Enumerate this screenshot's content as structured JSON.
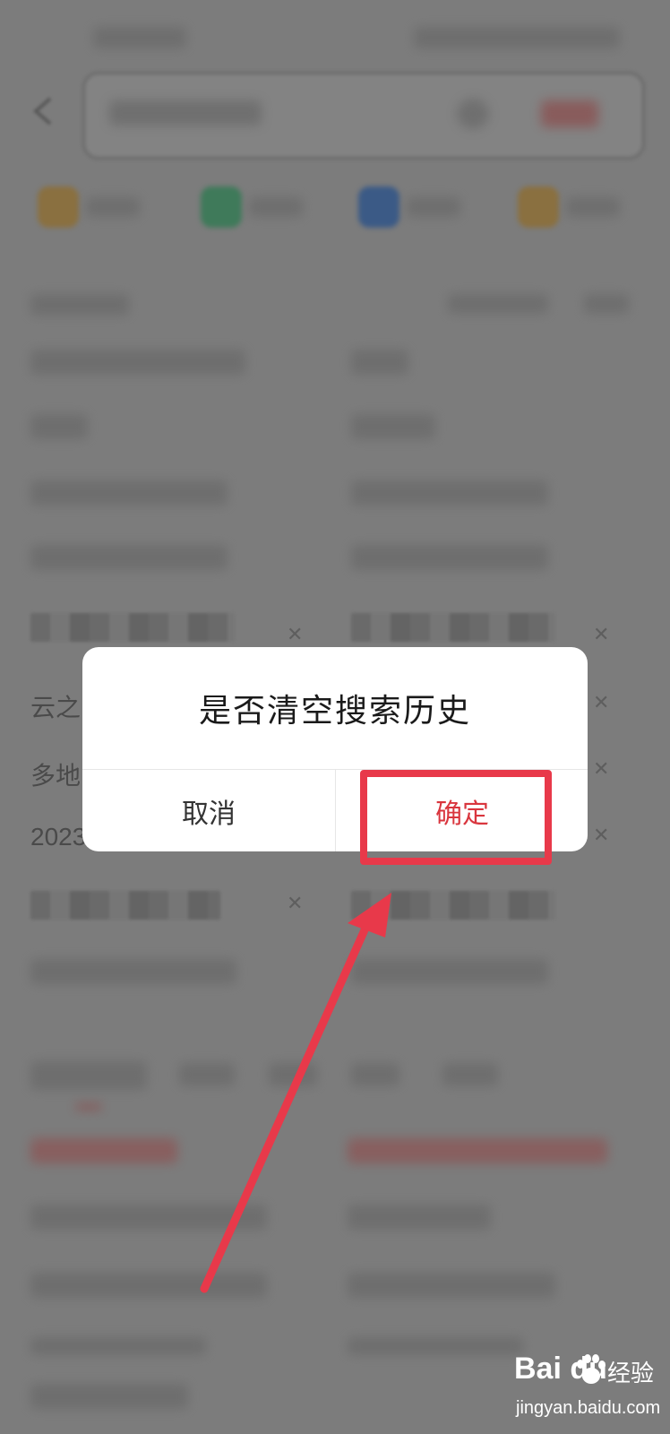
{
  "dialog": {
    "title": "是否清空搜索历史",
    "cancel_label": "取消",
    "confirm_label": "确定"
  },
  "peek_text": {
    "left_1": "云之",
    "left_2": "多地",
    "left_3": "2023"
  },
  "watermark": {
    "logo_text": "Bai du",
    "cn_text": "经验",
    "url": "jingyan.baidu.com"
  },
  "colors": {
    "overlay": "#7c7c7c",
    "dialog_bg": "#ffffff",
    "confirm_red": "#d9363e",
    "annotation_red": "#e8394a"
  },
  "icons": [
    "back-chevron-icon",
    "close-icon",
    "baidu-paw-icon"
  ]
}
